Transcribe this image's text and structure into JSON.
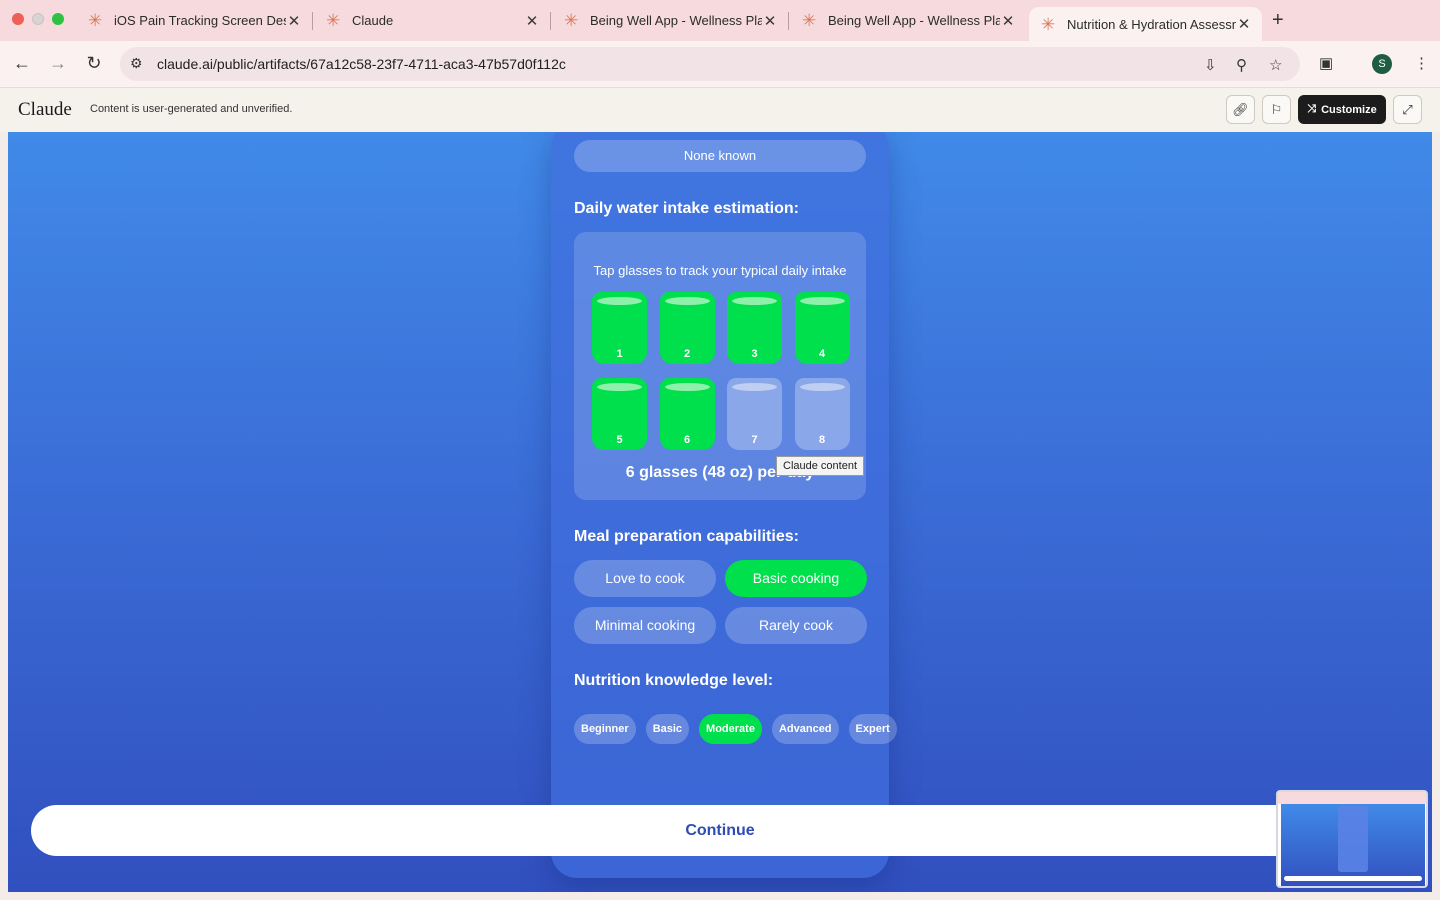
{
  "browser": {
    "tabs": [
      {
        "title": "iOS Pain Tracking Screen Des",
        "active": false
      },
      {
        "title": "Claude",
        "active": false
      },
      {
        "title": "Being Well App - Wellness Pla",
        "active": false
      },
      {
        "title": "Being Well App - Wellness Pla",
        "active": false
      },
      {
        "title": "Nutrition & Hydration Assessm",
        "active": true
      }
    ],
    "url": "claude.ai/public/artifacts/67a12c58-23f7-4711-aca3-47b57d0f112c",
    "avatar_initial": "S"
  },
  "claude_header": {
    "logo": "Claude",
    "note": "Content is user-generated and unverified.",
    "customize_label": "Customize"
  },
  "form": {
    "known_option": "None known",
    "water": {
      "title": "Daily water intake estimation:",
      "hint": "Tap glasses to track your typical daily intake",
      "glasses": [
        {
          "label": "1",
          "filled": true
        },
        {
          "label": "2",
          "filled": true
        },
        {
          "label": "3",
          "filled": true
        },
        {
          "label": "4",
          "filled": true
        },
        {
          "label": "5",
          "filled": true
        },
        {
          "label": "6",
          "filled": true
        },
        {
          "label": "7",
          "filled": false
        },
        {
          "label": "8",
          "filled": false
        }
      ],
      "total": "6 glasses (48 oz) per day"
    },
    "meal_prep": {
      "title": "Meal preparation capabilities:",
      "options": [
        "Love to cook",
        "Basic cooking",
        "Minimal cooking",
        "Rarely cook"
      ],
      "selected": "Basic cooking"
    },
    "knowledge": {
      "title": "Nutrition knowledge level:",
      "options": [
        "Beginner",
        "Basic",
        "Moderate",
        "Advanced",
        "Expert"
      ],
      "selected": "Moderate"
    },
    "continue_label": "Continue"
  },
  "tooltip": "Claude content",
  "colors": {
    "accent_green": "#00e04c",
    "background_blue": "#3a6bd6",
    "continue_text": "#2f4bb5"
  }
}
